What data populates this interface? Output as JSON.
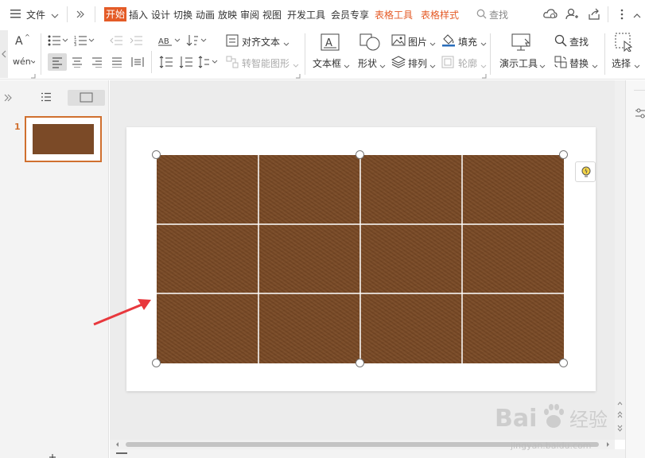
{
  "menubar": {
    "file_menu": "文件",
    "tabs": [
      {
        "label": "开始",
        "state": "active"
      },
      {
        "label": "插入"
      },
      {
        "label": "设计"
      },
      {
        "label": "切换"
      },
      {
        "label": "动画"
      },
      {
        "label": "放映"
      },
      {
        "label": "审阅"
      },
      {
        "label": "视图"
      },
      {
        "label": "开发工具"
      },
      {
        "label": "会员专享"
      },
      {
        "label": "表格工具",
        "state": "contextual"
      },
      {
        "label": "表格样式",
        "state": "contextual"
      }
    ],
    "search": "查找"
  },
  "ribbon": {
    "text_direction": "AB",
    "align_text": "对齐文本",
    "convert_smartart": "转智能图形",
    "textbox": "文本框",
    "shape": "形状",
    "picture": "图片",
    "arrange": "排列",
    "fill": "填充",
    "outline": "轮廓",
    "present_tools": "演示工具",
    "find": "查找",
    "replace": "替换",
    "select": "选择"
  },
  "slides_panel": {
    "slide_number": "1"
  },
  "table": {
    "rows": 3,
    "cols": 4,
    "cell_color": "#7a4a26"
  },
  "colors": {
    "accent": "#e45b27",
    "arrow": "#e8383d",
    "selection_border": "#d0702f"
  },
  "watermark": {
    "brand": "Baidu",
    "brand_cn": "经验",
    "url": "jingyan.baidu.com"
  }
}
